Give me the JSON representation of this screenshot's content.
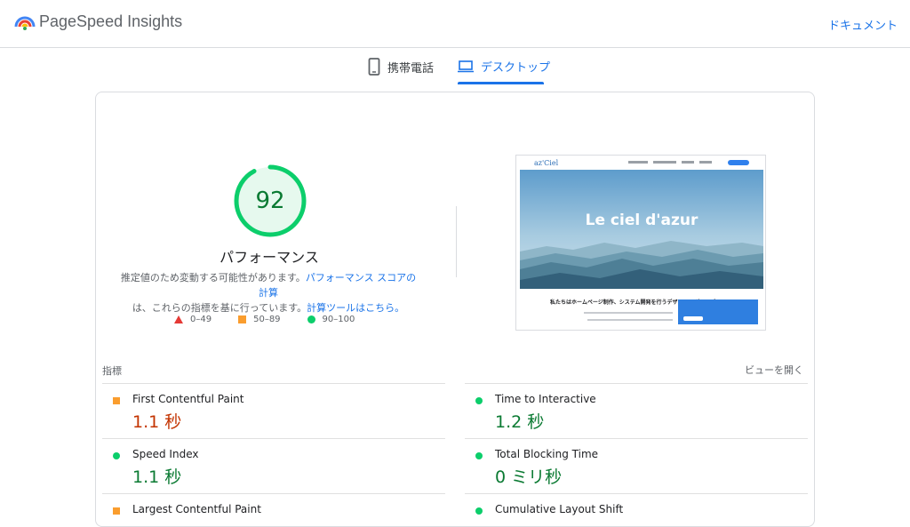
{
  "header": {
    "brand": "PageSpeed Insights",
    "docs_link": "ドキュメント"
  },
  "tabs": [
    {
      "label": "携帯電話",
      "icon": "smartphone-icon",
      "active": false
    },
    {
      "label": "デスクトップ",
      "icon": "laptop-icon",
      "active": true
    }
  ],
  "summary": {
    "score": "92",
    "category": "パフォーマンス",
    "desc_1": "推定値のため変動する可能性があります。",
    "desc_link_1": "パフォーマンス スコアの計算",
    "desc_2": "は、これらの指標を基に行っています。",
    "desc_link_2": "計算ツールはこちら。",
    "legend": [
      {
        "shape": "triangle",
        "range": "0–49",
        "color": "#e53935"
      },
      {
        "shape": "square",
        "range": "50–89",
        "color": "#fa9d2e"
      },
      {
        "shape": "circle",
        "range": "90–100",
        "color": "#0cce6b"
      }
    ],
    "gauge_color": "#0cce6b",
    "score_color": "#0a7a32"
  },
  "screenshot": {
    "logo": "az'Ciel",
    "hero_text": "Le ciel d'azur",
    "subheading": "私たちはホームページ制作、システム開発を行うデザイン...グループ"
  },
  "metrics_section": {
    "label": "指標",
    "expand": "ビューを開く"
  },
  "metrics": [
    {
      "name": "First Contentful Paint",
      "value": "1.1 秒",
      "rating": "average"
    },
    {
      "name": "Time to Interactive",
      "value": "1.2 秒",
      "rating": "good"
    },
    {
      "name": "Speed Index",
      "value": "1.1 秒",
      "rating": "good"
    },
    {
      "name": "Total Blocking Time",
      "value": "0 ミリ秒",
      "rating": "good"
    },
    {
      "name": "Largest Contentful Paint",
      "value": "",
      "rating": "average"
    },
    {
      "name": "Cumulative Layout Shift",
      "value": "",
      "rating": "good"
    }
  ]
}
